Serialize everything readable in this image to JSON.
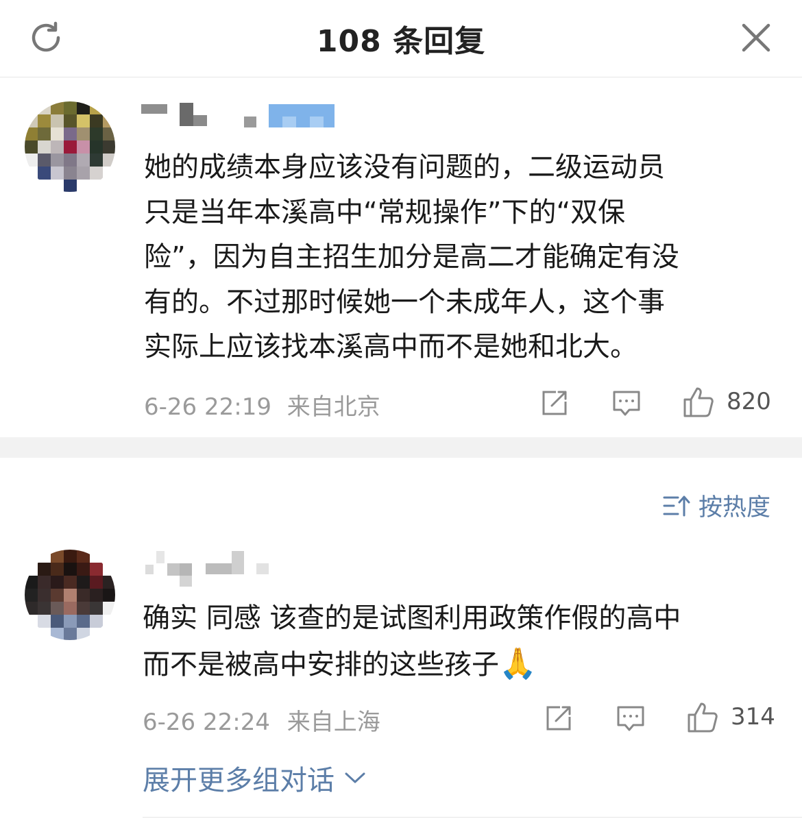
{
  "header": {
    "title": "108 条回复"
  },
  "comments": [
    {
      "text": "她的成绩本身应该没有问题的，二级运动员\n只是当年本溪高中“常规操作”下的“双保\n险”，因为自主招生加分是高二才能确定有没\n有的。不过那时候她一个未成年人，这个事\n实际上应该找本溪高中而不是她和北大。",
      "time": "6-26 22:19",
      "location": "来自北京",
      "likes": "820"
    },
    {
      "text": "确实 同感 该查的是试图利用政策作假的高中\n而不是被高中安排的这些孩子",
      "emoji": "🙏",
      "time": "6-26 22:24",
      "location": "来自上海",
      "likes": "314"
    }
  ],
  "sort": {
    "label": "按热度"
  },
  "expand": {
    "label": "展开更多组对话"
  },
  "colors": {
    "link": "#5c7ea8",
    "meta": "#9a9a9a",
    "divider": "#f2f2f2"
  }
}
